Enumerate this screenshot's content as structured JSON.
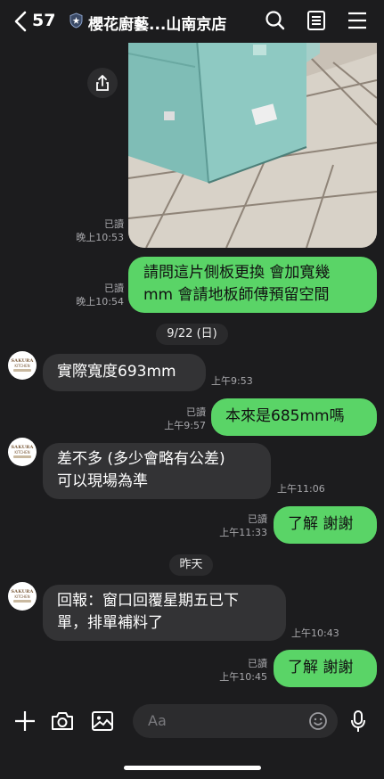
{
  "header": {
    "back_count": "57",
    "title": "櫻花廚藝...山南京店",
    "icons": [
      "chevron-left-icon",
      "shield-icon",
      "search-icon",
      "notes-icon",
      "menu-icon"
    ]
  },
  "messages": {
    "photo_read": "已讀",
    "photo_time": "晚上10:53",
    "m1_read": "已讀",
    "m1_time": "晚上10:54",
    "m1_line1": "請問這片側板更換 會加寬幾",
    "m1_line2": "mm 會請地板師傅預留空間",
    "date1": "9/22 (日)",
    "m2_text": "實際寬度693mm",
    "m2_time": "上午9:53",
    "m3_read": "已讀",
    "m3_time": "上午9:57",
    "m3_text": "本來是685mm嗎",
    "m4_line1": "差不多 (多少會略有公差)",
    "m4_line2": "可以現場為準",
    "m4_time": "上午11:06",
    "m5_read": "已讀",
    "m5_time": "上午11:33",
    "m5_text": "了解 謝謝",
    "date2": "昨天",
    "m6_line1": "回報：窗口回覆星期五已下",
    "m6_line2": "單，排單補料了",
    "m6_time": "上午10:43",
    "m7_read": "已讀",
    "m7_time": "上午10:45",
    "m7_text": "了解 謝謝"
  },
  "avatar": {
    "brand_line1": "SAKURA",
    "brand_line2": "KITCHEN"
  },
  "input": {
    "placeholder": "Aa"
  },
  "colors": {
    "background": "#1c1c1e",
    "outgoing_bubble": "#5ad467",
    "incoming_bubble": "#333335"
  }
}
